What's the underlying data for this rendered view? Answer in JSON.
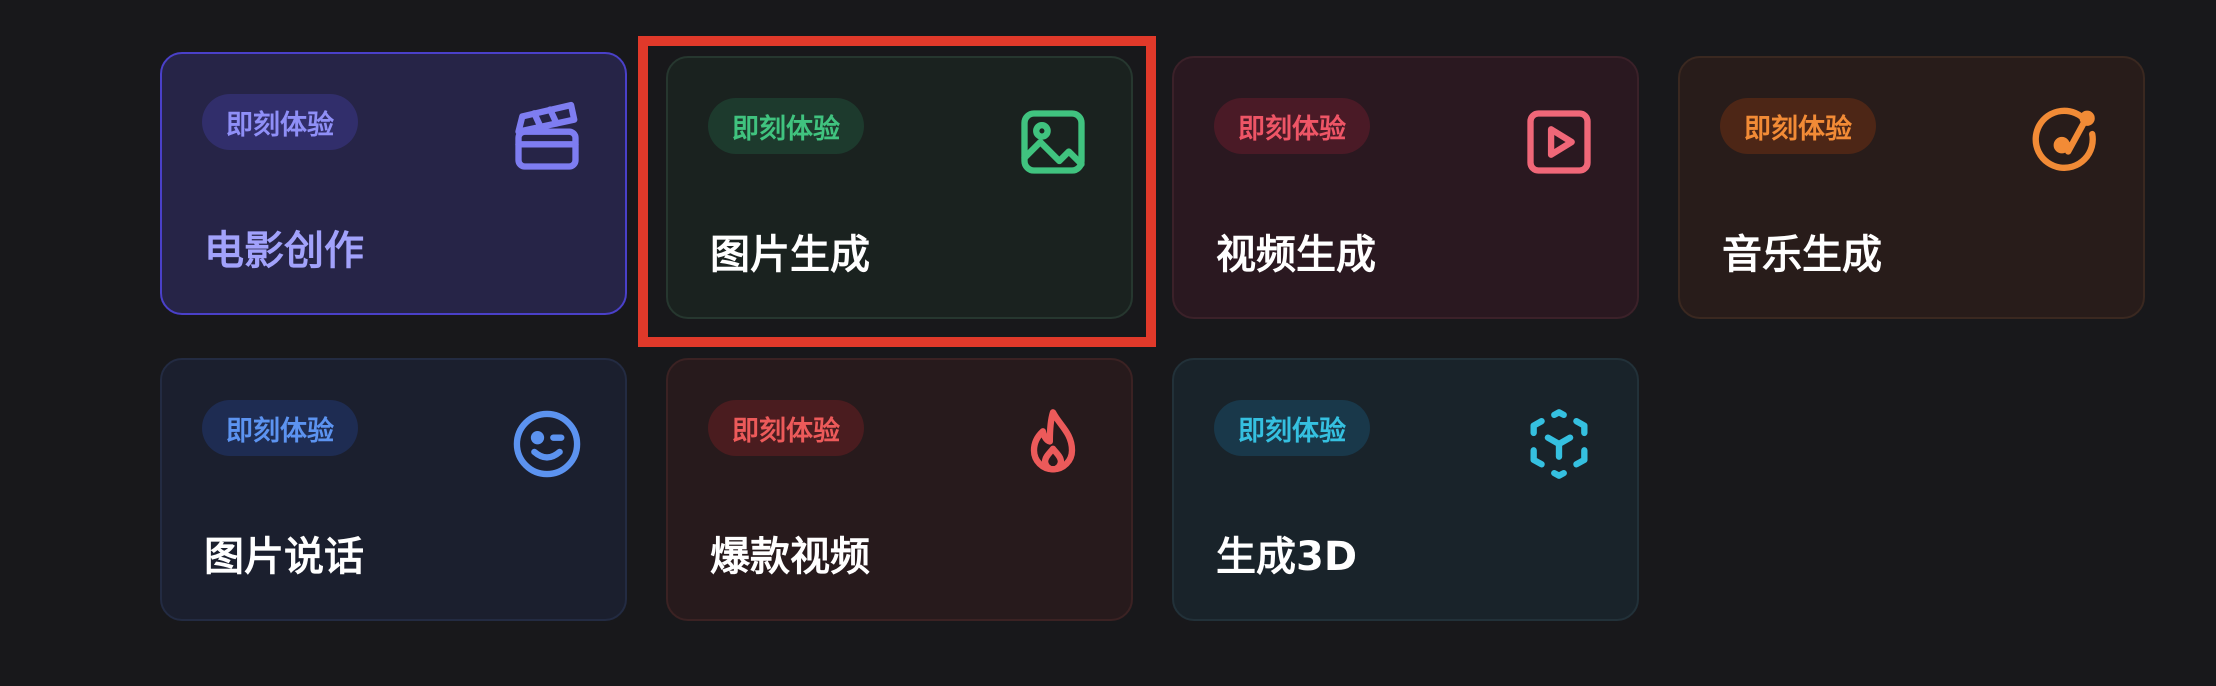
{
  "cards": [
    {
      "badge": "即刻体验",
      "title": "电影创作",
      "icon": "clapperboard-icon",
      "accent": "#7e7df1"
    },
    {
      "badge": "即刻体验",
      "title": "图片生成",
      "icon": "image-icon",
      "accent": "#40c37f",
      "highlighted": true
    },
    {
      "badge": "即刻体验",
      "title": "视频生成",
      "icon": "play-square-icon",
      "accent": "#f06778"
    },
    {
      "badge": "即刻体验",
      "title": "音乐生成",
      "icon": "music-disc-icon",
      "accent": "#f28b36"
    },
    {
      "badge": "即刻体验",
      "title": "图片说话",
      "icon": "wink-face-icon",
      "accent": "#5c93f0"
    },
    {
      "badge": "即刻体验",
      "title": "爆款视频",
      "icon": "flame-icon",
      "accent": "#ec5a5a"
    },
    {
      "badge": "即刻体验",
      "title": "生成3D",
      "icon": "cube-3d-icon",
      "accent": "#35c0e0"
    }
  ],
  "colors": {
    "background": "#18181b",
    "highlight_border": "#e0392a"
  }
}
